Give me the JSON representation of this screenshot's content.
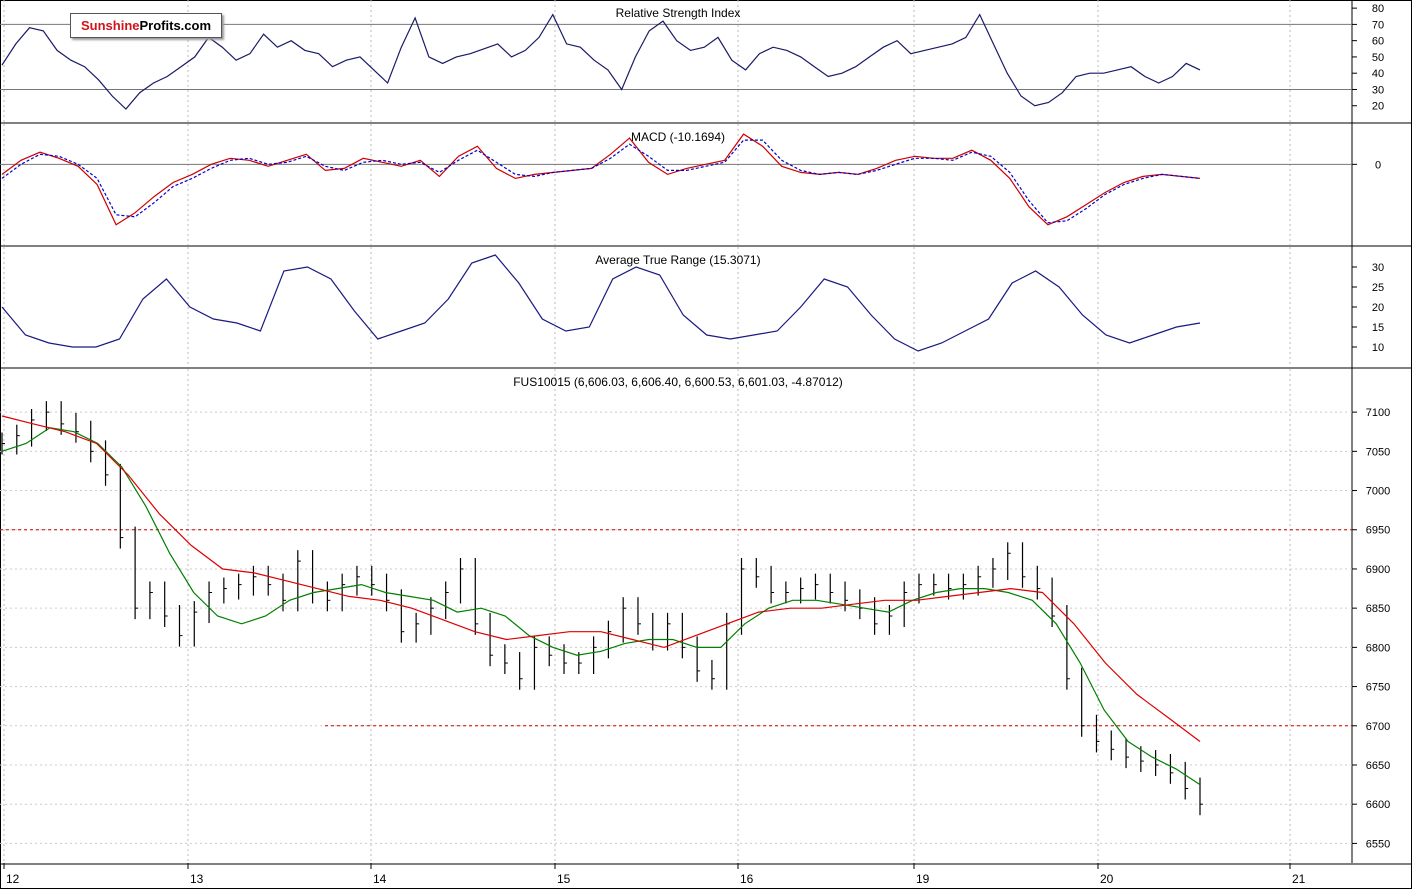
{
  "logo": {
    "part1": "Sunshine",
    "part2": "Profits.com"
  },
  "chart_data": [
    {
      "type": "line",
      "title": "Relative Strength Index",
      "yticks": [
        80,
        70,
        60,
        50,
        40,
        30,
        20
      ],
      "ylim": [
        10,
        85
      ],
      "hlines": [
        70,
        30
      ],
      "series": [
        {
          "values": [
            45,
            58,
            68,
            66,
            54,
            48,
            44,
            36,
            26,
            18,
            28,
            34,
            38,
            44,
            50,
            62,
            56,
            48,
            52,
            64,
            56,
            60,
            54,
            52,
            44,
            48,
            50,
            42,
            34,
            56,
            74,
            50,
            46,
            50,
            52,
            55,
            58,
            50,
            54,
            62,
            76,
            58,
            56,
            48,
            42,
            30,
            50,
            66,
            72,
            60,
            54,
            56,
            62,
            48,
            42,
            52,
            56,
            54,
            50,
            44,
            38,
            40,
            44,
            50,
            56,
            60,
            52,
            54,
            56,
            58,
            62,
            76,
            58,
            40,
            26,
            20,
            22,
            28,
            38,
            40,
            40,
            42,
            44,
            38,
            34,
            38,
            46,
            42
          ],
          "color": "#1a1a66"
        }
      ]
    },
    {
      "type": "line",
      "title": "MACD (-10.1694)",
      "yticks": [
        0
      ],
      "ylim": [
        -80,
        40
      ],
      "series": [
        {
          "values": [
            -10,
            4,
            12,
            6,
            -2,
            -20,
            -60,
            -48,
            -32,
            -18,
            -10,
            0,
            6,
            4,
            -2,
            4,
            10,
            -6,
            -4,
            6,
            2,
            -2,
            4,
            -12,
            8,
            18,
            -4,
            -14,
            -10,
            -8,
            -6,
            -4,
            10,
            26,
            2,
            -10,
            -4,
            0,
            4,
            30,
            18,
            -2,
            -8,
            -10,
            -8,
            -10,
            -4,
            4,
            8,
            6,
            6,
            14,
            4,
            -14,
            -42,
            -60,
            -52,
            -40,
            -28,
            -18,
            -12,
            -10,
            -12,
            -14
          ],
          "color": "#cc0000"
        },
        {
          "values": [
            -14,
            0,
            10,
            8,
            0,
            -14,
            -50,
            -52,
            -38,
            -22,
            -14,
            -4,
            4,
            6,
            0,
            2,
            8,
            -2,
            -6,
            2,
            4,
            0,
            2,
            -8,
            4,
            14,
            2,
            -10,
            -12,
            -8,
            -6,
            -4,
            6,
            20,
            8,
            -6,
            -6,
            -2,
            2,
            24,
            24,
            4,
            -6,
            -10,
            -8,
            -10,
            -6,
            0,
            6,
            6,
            4,
            12,
            8,
            -8,
            -36,
            -58,
            -56,
            -44,
            -30,
            -20,
            -14,
            -10,
            -12,
            -14
          ],
          "color": "#0000cc",
          "dashed": true
        }
      ]
    },
    {
      "type": "line",
      "title": "Average True Range (15.3071)",
      "yticks": [
        30,
        25,
        20,
        15,
        10
      ],
      "ylim": [
        5,
        35
      ],
      "series": [
        {
          "values": [
            20,
            13,
            11,
            10,
            10,
            12,
            22,
            27,
            20,
            17,
            16,
            14,
            29,
            30,
            27,
            19,
            12,
            14,
            16,
            22,
            31,
            33,
            26,
            17,
            14,
            15,
            27,
            30,
            28,
            18,
            13,
            12,
            13,
            14,
            20,
            27,
            25,
            18,
            12,
            9,
            11,
            14,
            17,
            26,
            29,
            25,
            18,
            13,
            11,
            13,
            15,
            16
          ],
          "color": "#1a1a80"
        }
      ]
    },
    {
      "type": "bar",
      "title": "FUS10015 (6,606.03, 6,606.40, 6,600.53, 6,601.03, -4.87012)",
      "yticks": [
        7100,
        7050,
        7000,
        6950,
        6900,
        6850,
        6800,
        6750,
        6700,
        6650,
        6600,
        6550
      ],
      "ylim": [
        6525,
        7155
      ],
      "hlines": [
        6950,
        6700
      ],
      "close": [
        7060,
        7070,
        7090,
        7100,
        7085,
        7075,
        7050,
        7020,
        6940,
        6850,
        6870,
        6840,
        6815,
        6845,
        6870,
        6875,
        6880,
        6890,
        6880,
        6860,
        6910,
        6870,
        6860,
        6880,
        6890,
        6880,
        6860,
        6820,
        6830,
        6850,
        6870,
        6900,
        6830,
        6790,
        6780,
        6760,
        6800,
        6790,
        6780,
        6780,
        6800,
        6820,
        6850,
        6830,
        6810,
        6830,
        6800,
        6770,
        6760,
        6830,
        6900,
        6890,
        6870,
        6870,
        6875,
        6880,
        6870,
        6860,
        6850,
        6830,
        6840,
        6870,
        6880,
        6880,
        6875,
        6880,
        6890,
        6900,
        6920,
        6890,
        6875,
        6840,
        6760,
        6700,
        6680,
        6670,
        6660,
        6655,
        6650,
        6640,
        6620,
        6600
      ],
      "sma_short": [
        7050,
        7060,
        7080,
        7075,
        7060,
        7030,
        6980,
        6920,
        6870,
        6840,
        6830,
        6840,
        6860,
        6870,
        6875,
        6880,
        6870,
        6865,
        6860,
        6845,
        6850,
        6840,
        6815,
        6800,
        6790,
        6795,
        6805,
        6810,
        6810,
        6800,
        6800,
        6830,
        6850,
        6860,
        6860,
        6855,
        6850,
        6845,
        6860,
        6870,
        6875,
        6875,
        6870,
        6860,
        6830,
        6780,
        6720,
        6680,
        6660,
        6645,
        6625
      ],
      "sma_long": [
        7095,
        7085,
        7075,
        7060,
        7020,
        6970,
        6930,
        6900,
        6895,
        6885,
        6875,
        6865,
        6860,
        6850,
        6835,
        6820,
        6810,
        6815,
        6820,
        6820,
        6810,
        6800,
        6815,
        6830,
        6845,
        6850,
        6850,
        6855,
        6860,
        6860,
        6865,
        6870,
        6875,
        6870,
        6830,
        6780,
        6740,
        6710,
        6680
      ],
      "x_labels": [
        "12",
        "13",
        "14",
        "15",
        "16",
        "19",
        "20",
        "21"
      ],
      "colors": {
        "sma_short": "#008000",
        "sma_long": "#dd0000",
        "bars": "#000000"
      }
    }
  ]
}
